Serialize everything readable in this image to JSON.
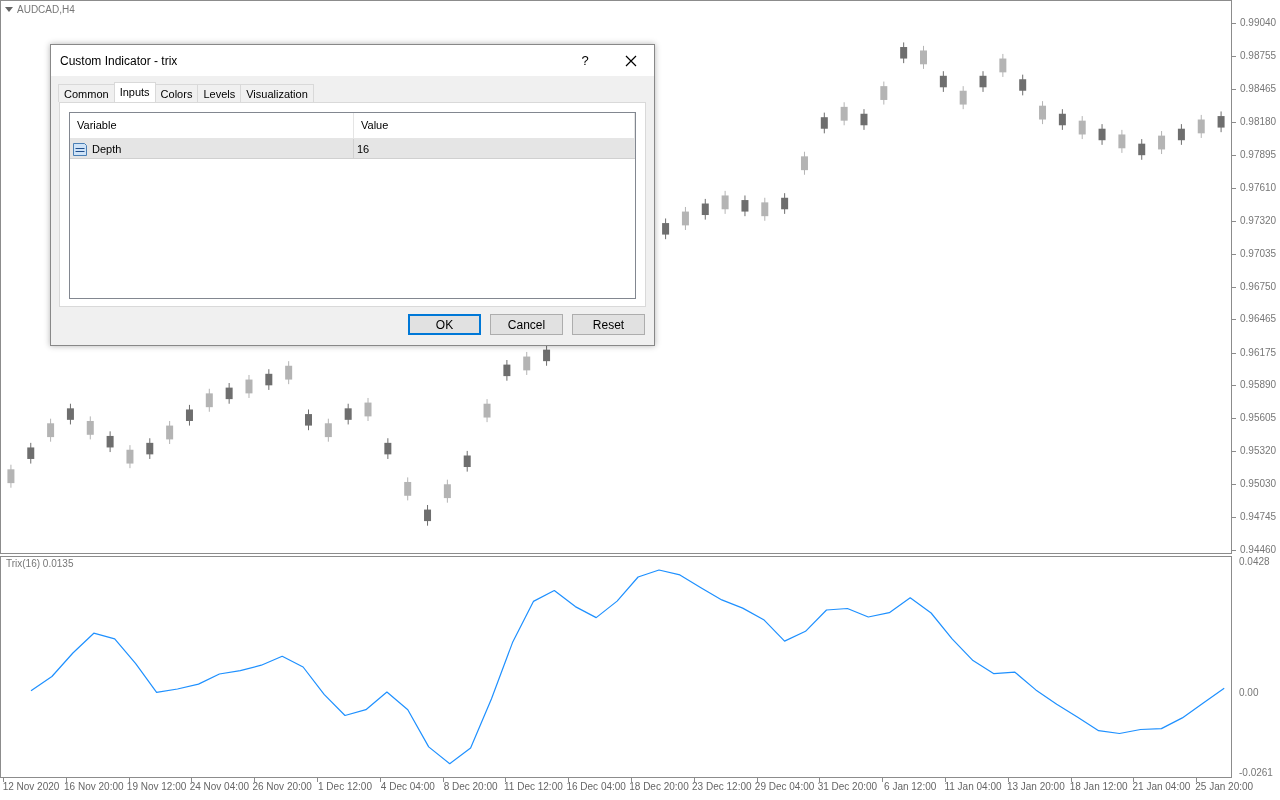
{
  "chart": {
    "title": "AUDCAD,H4",
    "chart_data": {
      "type": "candlestick",
      "categories": [
        null,
        null,
        null,
        null,
        null,
        null,
        null,
        null,
        null,
        null,
        null,
        null,
        null,
        null,
        null,
        null,
        null,
        null,
        null,
        null,
        null,
        null,
        null,
        null,
        null,
        null,
        null,
        null,
        null,
        null,
        null,
        null,
        null,
        null,
        null,
        null,
        null,
        null,
        null,
        null,
        null,
        null,
        null,
        null,
        null,
        null,
        null,
        null,
        null,
        null,
        null,
        null,
        null,
        null,
        null,
        null,
        null,
        null,
        null,
        null,
        null,
        null
      ],
      "ohlc": [
        [
          0.9505,
          0.9521,
          0.9501,
          0.9517
        ],
        [
          0.9536,
          0.954,
          0.9522,
          0.9526
        ],
        [
          0.9545,
          0.9561,
          0.9541,
          0.9557
        ],
        [
          0.957,
          0.9574,
          0.9556,
          0.956
        ],
        [
          0.9547,
          0.9563,
          0.9543,
          0.9559
        ],
        [
          0.9546,
          0.955,
          0.9532,
          0.9536
        ],
        [
          0.9522,
          0.9538,
          0.9518,
          0.9534
        ],
        [
          0.954,
          0.9544,
          0.9526,
          0.953
        ],
        [
          0.9543,
          0.9559,
          0.9539,
          0.9555
        ],
        [
          0.9569,
          0.9573,
          0.9555,
          0.9559
        ],
        [
          0.9571,
          0.9587,
          0.9567,
          0.9583
        ],
        [
          0.9588,
          0.9592,
          0.9574,
          0.9578
        ],
        [
          0.9583,
          0.9599,
          0.9579,
          0.9595
        ],
        [
          0.96,
          0.9604,
          0.9586,
          0.959
        ],
        [
          0.9595,
          0.9611,
          0.9591,
          0.9607
        ],
        [
          0.9565,
          0.9569,
          0.9551,
          0.9555
        ],
        [
          0.9545,
          0.9561,
          0.9541,
          0.9557
        ],
        [
          0.957,
          0.9574,
          0.9556,
          0.956
        ],
        [
          0.9563,
          0.9579,
          0.9559,
          0.9575
        ],
        [
          0.954,
          0.9544,
          0.9526,
          0.953
        ],
        [
          0.9494,
          0.951,
          0.949,
          0.9506
        ],
        [
          0.9482,
          0.9486,
          0.9468,
          0.9472
        ],
        [
          0.9492,
          0.9508,
          0.9488,
          0.9504
        ],
        [
          0.9529,
          0.9533,
          0.9515,
          0.9519
        ],
        [
          0.9562,
          0.9578,
          0.9558,
          0.9574
        ],
        [
          0.9608,
          0.9612,
          0.9594,
          0.9598
        ],
        [
          0.9603,
          0.9619,
          0.9599,
          0.9615
        ],
        [
          0.9621,
          0.9625,
          0.9607,
          0.9611
        ],
        null,
        null,
        null,
        null,
        null,
        [
          0.9731,
          0.9735,
          0.9717,
          0.9721
        ],
        [
          0.9729,
          0.9745,
          0.9725,
          0.9741
        ],
        [
          0.9748,
          0.9752,
          0.9734,
          0.9738
        ],
        [
          0.9743,
          0.9759,
          0.9739,
          0.9755
        ],
        [
          0.9751,
          0.9755,
          0.9737,
          0.9741
        ],
        [
          0.9737,
          0.9753,
          0.9733,
          0.9749
        ],
        [
          0.9753,
          0.9757,
          0.9739,
          0.9743
        ],
        [
          0.9777,
          0.9793,
          0.9773,
          0.9789
        ],
        [
          0.9823,
          0.9827,
          0.9809,
          0.9813
        ],
        [
          0.982,
          0.9836,
          0.9816,
          0.9832
        ],
        [
          0.9826,
          0.983,
          0.9812,
          0.9816
        ],
        [
          0.9838,
          0.9854,
          0.9834,
          0.985
        ],
        [
          0.9884,
          0.9888,
          0.987,
          0.9874
        ],
        [
          0.9869,
          0.9885,
          0.9865,
          0.9881
        ],
        [
          0.9859,
          0.9863,
          0.9845,
          0.9849
        ],
        [
          0.9834,
          0.985,
          0.983,
          0.9846
        ],
        [
          0.9859,
          0.9863,
          0.9845,
          0.9849
        ],
        [
          0.9862,
          0.9878,
          0.9858,
          0.9874
        ],
        [
          0.9856,
          0.986,
          0.9842,
          0.9846
        ],
        [
          0.9821,
          0.9837,
          0.9817,
          0.9833
        ],
        [
          0.9826,
          0.983,
          0.9812,
          0.9816
        ],
        [
          0.9808,
          0.9824,
          0.9804,
          0.982
        ],
        [
          0.9813,
          0.9817,
          0.9799,
          0.9803
        ],
        [
          0.9796,
          0.9812,
          0.9792,
          0.9808
        ],
        [
          0.98,
          0.9804,
          0.9786,
          0.979
        ],
        [
          0.9795,
          0.9811,
          0.9791,
          0.9807
        ],
        [
          0.9813,
          0.9817,
          0.9799,
          0.9803
        ],
        [
          0.9809,
          0.9825,
          0.9805,
          0.9821
        ],
        [
          0.9824,
          0.9828,
          0.981,
          0.9814
        ]
      ],
      "ylim": [
        0.94434,
        0.9924
      ],
      "yticks": [
        {
          "value": 0.9904,
          "label": "0.99040"
        },
        {
          "value": 0.98755,
          "label": "0.98755"
        },
        {
          "value": 0.98465,
          "label": "0.98465"
        },
        {
          "value": 0.9818,
          "label": "0.98180"
        },
        {
          "value": 0.97895,
          "label": "0.97895"
        },
        {
          "value": 0.9761,
          "label": "0.97610"
        },
        {
          "value": 0.9732,
          "label": "0.97320"
        },
        {
          "value": 0.97035,
          "label": "0.97035"
        },
        {
          "value": 0.9675,
          "label": "0.96750"
        },
        {
          "value": 0.96465,
          "label": "0.96465"
        },
        {
          "value": 0.96175,
          "label": "0.96175"
        },
        {
          "value": 0.9589,
          "label": "0.95890"
        },
        {
          "value": 0.95605,
          "label": "0.95605"
        },
        {
          "value": 0.9532,
          "label": "0.95320"
        },
        {
          "value": 0.9503,
          "label": "0.95030"
        },
        {
          "value": 0.94745,
          "label": "0.94745"
        },
        {
          "value": 0.9446,
          "label": "0.94460"
        }
      ]
    }
  },
  "indicator": {
    "label": "Trix(16) 0.0135",
    "chart_data": {
      "type": "line",
      "categories": [
        "12 Nov 2020",
        null,
        null,
        "16 Nov 20:00",
        null,
        null,
        "19 Nov 12:00",
        null,
        null,
        "24 Nov 04:00",
        null,
        null,
        "26 Nov 20:00",
        null,
        null,
        "1 Dec 12:00",
        null,
        null,
        "4 Dec 04:00",
        null,
        null,
        "8 Dec 20:00",
        null,
        null,
        "11 Dec 12:00",
        null,
        null,
        "16 Dec 04:00",
        null,
        null,
        "18 Dec 20:00",
        null,
        null,
        "23 Dec 12:00",
        null,
        null,
        "29 Dec 04:00",
        null,
        null,
        "31 Dec 20:00",
        null,
        null,
        "6 Jan 12:00",
        null,
        null,
        "11 Jan 04:00",
        null,
        null,
        "13 Jan 20:00",
        null,
        null,
        "18 Jan 12:00",
        null,
        null,
        "21 Jan 04:00",
        null,
        null,
        "25 Jan 20:00"
      ],
      "series": [
        {
          "color": "#1e90ff",
          "values": [
            0.0007,
            0.0054,
            0.0131,
            0.0196,
            0.0177,
            0.0096,
            0.0002,
            0.0013,
            0.0029,
            0.0062,
            0.0073,
            0.0091,
            0.012,
            0.0085,
            -0.0005,
            -0.0074,
            -0.0055,
            0.0003,
            -0.0055,
            -0.0177,
            -0.0232,
            -0.0181,
            -0.0019,
            0.0165,
            0.03,
            0.0336,
            0.0283,
            0.0247,
            0.0301,
            0.038,
            0.0403,
            0.0387,
            0.0345,
            0.0305,
            0.0278,
            0.024,
            0.017,
            0.0202,
            0.0272,
            0.0277,
            0.0249,
            0.0263,
            0.0312,
            0.0262,
            0.0177,
            0.0106,
            0.0063,
            0.0068,
            0.001,
            -0.0037,
            -0.008,
            -0.0124,
            -0.0133,
            -0.012,
            -0.0117,
            -0.0082,
            -0.0033,
            0.0015
          ]
        }
      ],
      "ylim": [
        -0.0279,
        0.0449
      ],
      "yticks": [
        {
          "value": 0.0428,
          "label": "0.0428"
        },
        {
          "value": 0,
          "label": "0.00"
        },
        {
          "value": -0.0261,
          "label": "-0.0261"
        }
      ]
    }
  },
  "dialog": {
    "title": "Custom Indicator - trix",
    "help": "?",
    "tabs": [
      {
        "label": "Common",
        "selected": false
      },
      {
        "label": "Inputs",
        "selected": true
      },
      {
        "label": "Colors",
        "selected": false
      },
      {
        "label": "Levels",
        "selected": false
      },
      {
        "label": "Visualization",
        "selected": false
      }
    ],
    "table": {
      "columns": [
        "Variable",
        "Value"
      ],
      "rows": [
        {
          "variable": "Depth",
          "value": "16",
          "selected": true
        }
      ]
    },
    "buttons": [
      {
        "label": "OK",
        "default": true
      },
      {
        "label": "Cancel",
        "default": false
      },
      {
        "label": "Reset",
        "default": false
      }
    ]
  }
}
